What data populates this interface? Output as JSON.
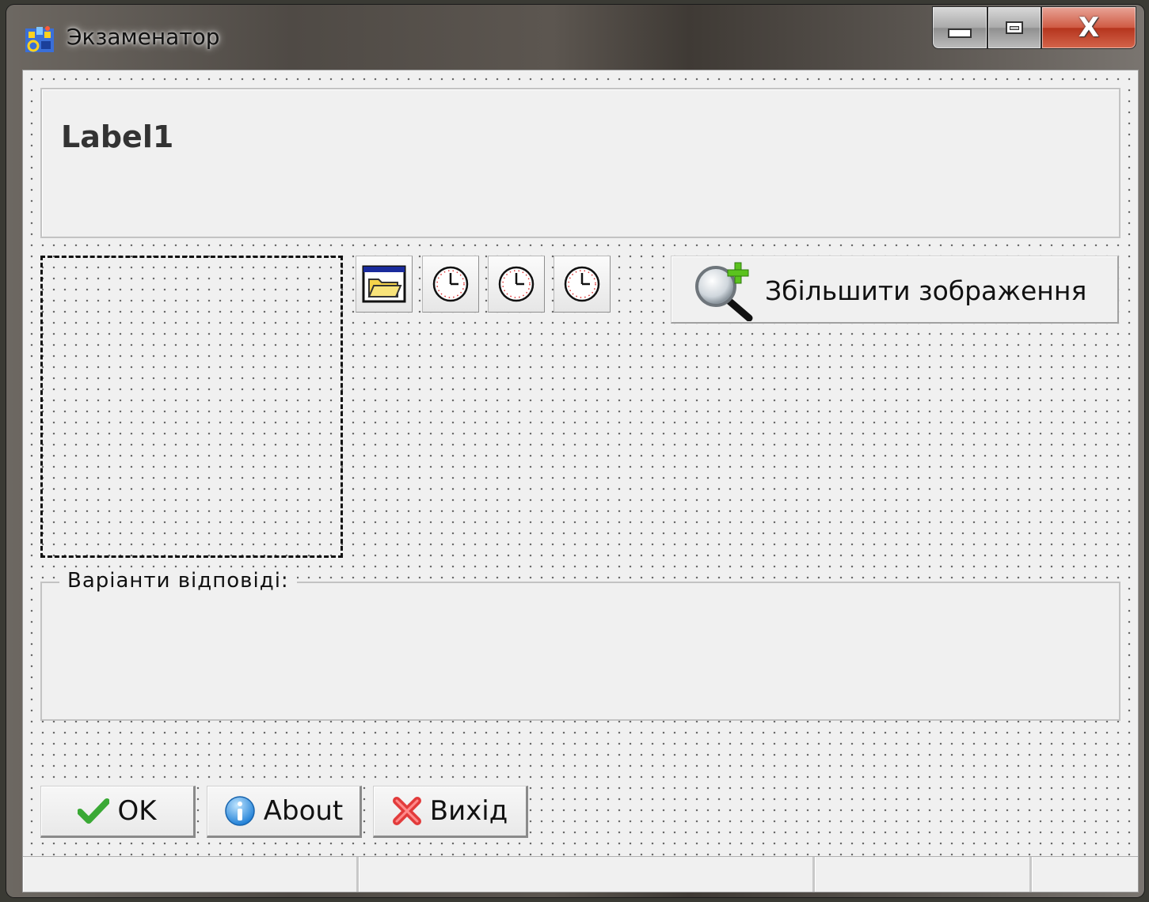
{
  "window": {
    "title": "Экзаменатор",
    "icons": {
      "app": "app-icon",
      "minimize": "minimize-icon",
      "maximize": "maximize-icon",
      "close": "close-icon"
    },
    "close_glyph": "X"
  },
  "header_panel": {
    "label": "Label1"
  },
  "toolbar": {
    "buttons": [
      {
        "icon": "open-folder-icon"
      },
      {
        "icon": "clock-icon"
      },
      {
        "icon": "clock-icon"
      },
      {
        "icon": "clock-icon"
      }
    ]
  },
  "zoom_button": {
    "label": "Збільшити зображення",
    "icon": "zoom-in-icon"
  },
  "answers_group": {
    "legend": "Варіанти відповіді:"
  },
  "buttons": {
    "ok": {
      "label": "OK",
      "icon": "checkmark-icon",
      "icon_color": "#3aa935"
    },
    "about": {
      "label": "About",
      "icon": "info-icon",
      "icon_color": "#2a8fe0"
    },
    "exit": {
      "label": "Вихід",
      "icon": "close-x-icon",
      "icon_color": "#e23b3b"
    }
  },
  "statusbar": {
    "panels": [
      "",
      "",
      "",
      ""
    ]
  }
}
